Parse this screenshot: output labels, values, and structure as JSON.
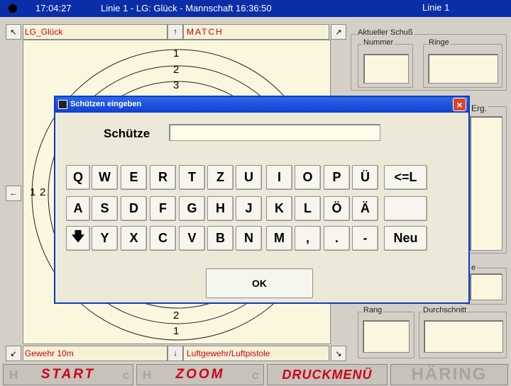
{
  "titlebar": {
    "time": "17:04:27",
    "title": "Linie 1 - LG: Glück - Mannschaft 16:36:50",
    "line": "Linie 1"
  },
  "top_labels": {
    "left": "LG_Glück",
    "center": "MATCH",
    "left_arrow": "↖",
    "center_arrow": "↑",
    "right_arrow": "↗"
  },
  "bottom_labels": {
    "left": "Gewehr 10m",
    "center": "Luftgewehr/Luftpistole",
    "left_arrow": "↙",
    "center_arrow": "↓",
    "right_arrow": "↘",
    "side_arrow": "←"
  },
  "target": {
    "ring_labels_top": [
      "1",
      "2",
      "3"
    ],
    "ring_labels_bottom": [
      "2",
      "1"
    ],
    "ring_labels_left": [
      "1",
      "2"
    ]
  },
  "right_panel": {
    "current_shot": "Aktueller Schuß",
    "number": "Nummer",
    "rings": "Ringe",
    "result": "Erg.",
    "partial": "e",
    "rank": "Rang",
    "average": "Durchschnitt"
  },
  "bottom_buttons": {
    "start": "START",
    "zoom": "ZOOM",
    "print": "DRUCKMENÜ",
    "brand": "HÄRING",
    "ghost": "H",
    "ghost_c": "c"
  },
  "dialog": {
    "title": "Schützen eingeben",
    "close": "×",
    "name_label": "Schütze",
    "name_value": "",
    "ok": "OK",
    "keys_row1": [
      "Q",
      "W",
      "E",
      "R",
      "T",
      "Z",
      "U",
      "I",
      "O",
      "P",
      "Ü",
      "<=L"
    ],
    "keys_row2": [
      "A",
      "S",
      "D",
      "F",
      "G",
      "H",
      "J",
      "K",
      "L",
      "Ö",
      "Ä",
      ""
    ],
    "keys_row3": [
      "🡇",
      "Y",
      "X",
      "C",
      "V",
      "B",
      "N",
      "M",
      ",",
      ".",
      "-",
      "Neu"
    ]
  }
}
